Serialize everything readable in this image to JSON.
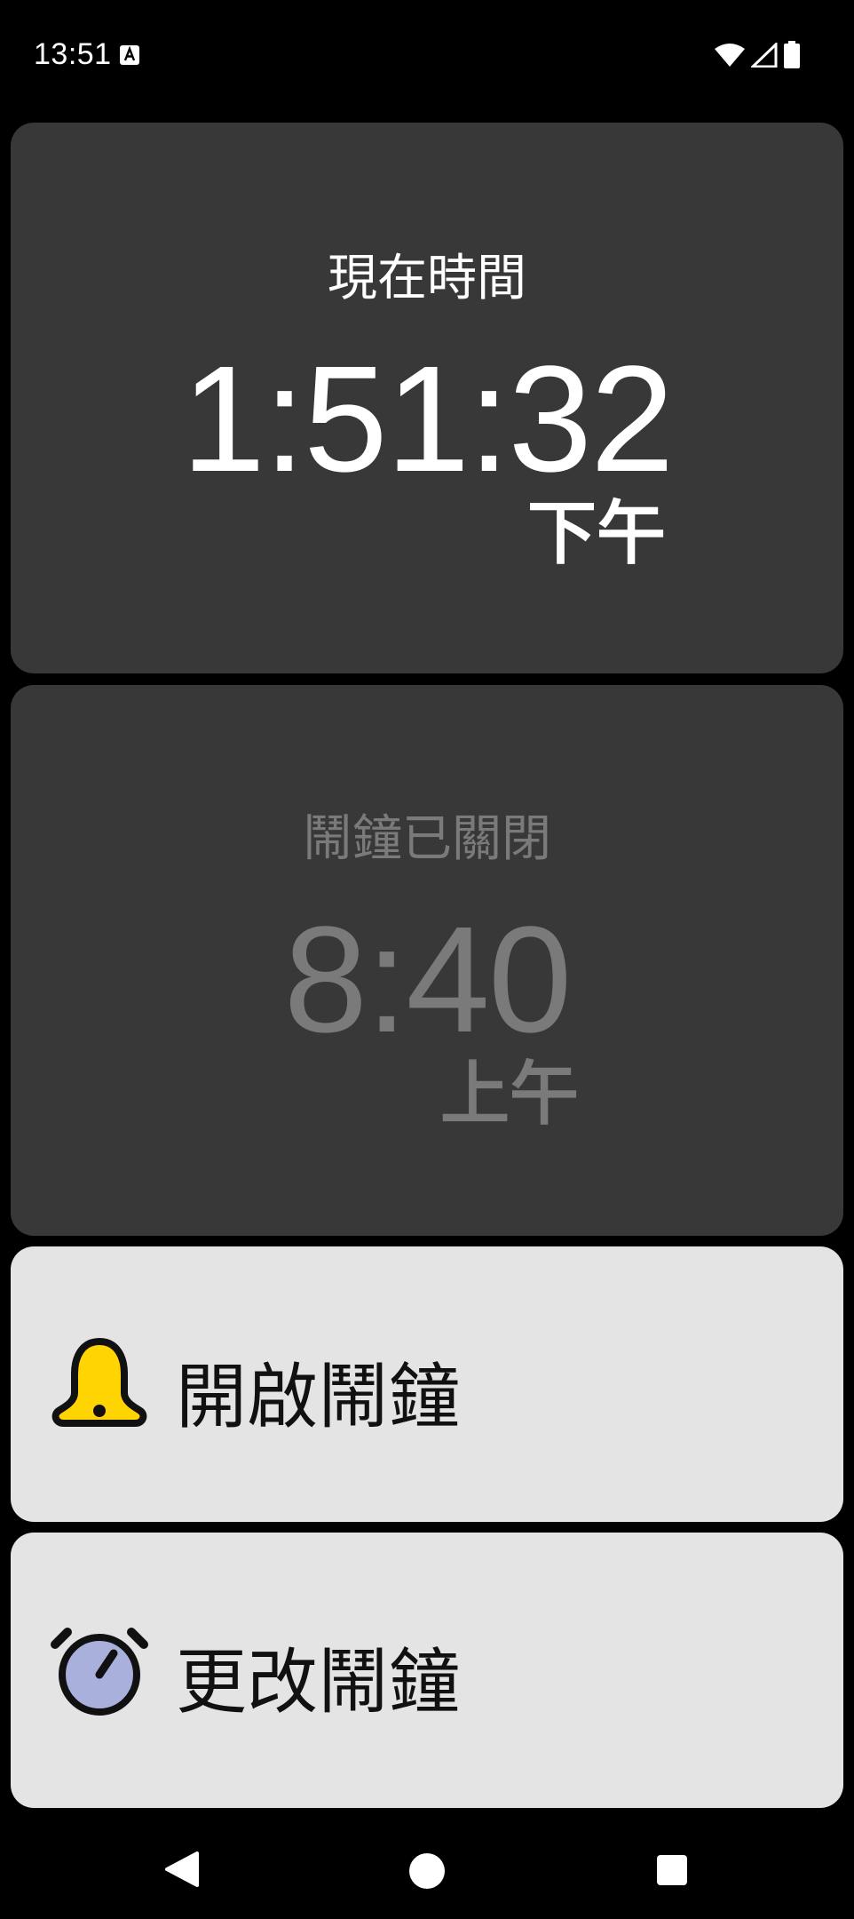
{
  "status_bar": {
    "time": "13:51",
    "icons": [
      "a-notification-icon",
      "wifi-icon",
      "cell-signal-icon",
      "battery-icon"
    ]
  },
  "clock": {
    "label": "現在時間",
    "time": "1:51:32",
    "ampm": "下午"
  },
  "alarm": {
    "status": "鬧鐘已關閉",
    "time": "8:40",
    "ampm": "上午",
    "enabled": false
  },
  "actions": {
    "enable_label": "開啟鬧鐘",
    "enable_icon": "bell-icon",
    "change_label": "更改鬧鐘",
    "change_icon": "alarm-clock-icon"
  },
  "nav": {
    "icons": [
      "back-icon",
      "home-icon",
      "recents-icon"
    ]
  },
  "colors": {
    "background": "#000000",
    "card_dark": "#383838",
    "card_light": "#e4e4e4",
    "disabled_text": "#7a7a7a",
    "bell_yellow": "#ffd400",
    "clock_face": "#aab0dc"
  }
}
